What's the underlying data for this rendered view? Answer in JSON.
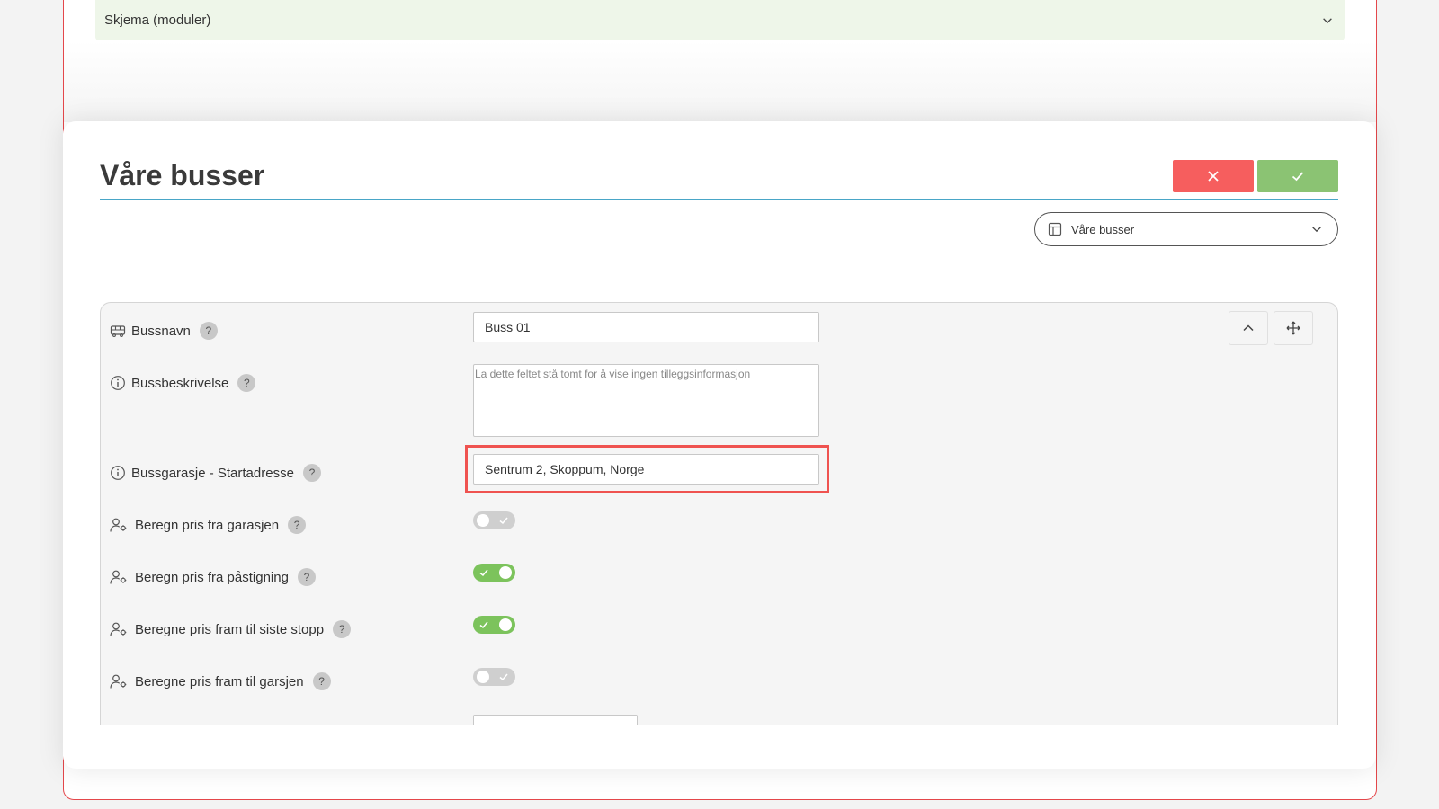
{
  "accordion": {
    "label": "Skjema (moduler)",
    "icon": "chevron-down-icon"
  },
  "modal": {
    "title": "Våre busser",
    "cancel_icon": "close-icon",
    "confirm_icon": "check-icon",
    "layout_select": {
      "value": "Våre busser",
      "icon": "layout-icon"
    }
  },
  "form": {
    "toolbar": {
      "collapse_icon": "chevron-up-icon",
      "move_icon": "move-icon"
    },
    "fields": {
      "bussnavn": {
        "label": "Bussnavn",
        "value": "Buss 01",
        "icon": "bus-icon"
      },
      "bussbeskrivelse": {
        "label": "Bussbeskrivelse",
        "placeholder": "La dette feltet stå tomt for å vise ingen tilleggsinformasjon",
        "icon": "info-icon"
      },
      "startadresse": {
        "label": "Bussgarasje - Startadresse",
        "value": "Sentrum 2, Skoppum, Norge",
        "icon": "info-icon"
      }
    },
    "toggles": [
      {
        "label": "Beregn pris fra garasjen",
        "on": false,
        "icon": "person-settings-icon"
      },
      {
        "label": "Beregn pris fra påstigning",
        "on": true,
        "icon": "person-settings-icon"
      },
      {
        "label": "Beregne pris fram til siste stopp",
        "on": true,
        "icon": "person-settings-icon"
      },
      {
        "label": "Beregne pris fram til garsjen",
        "on": false,
        "icon": "person-settings-icon"
      }
    ],
    "help_glyph": "?"
  },
  "colors": {
    "cancel": "#f65e5e",
    "confirm": "#8bc373",
    "accent_rule": "#49a6c7",
    "highlight": "#ef5350",
    "toggle_on": "#7cc35c",
    "toggle_off": "#cfcfcf"
  }
}
